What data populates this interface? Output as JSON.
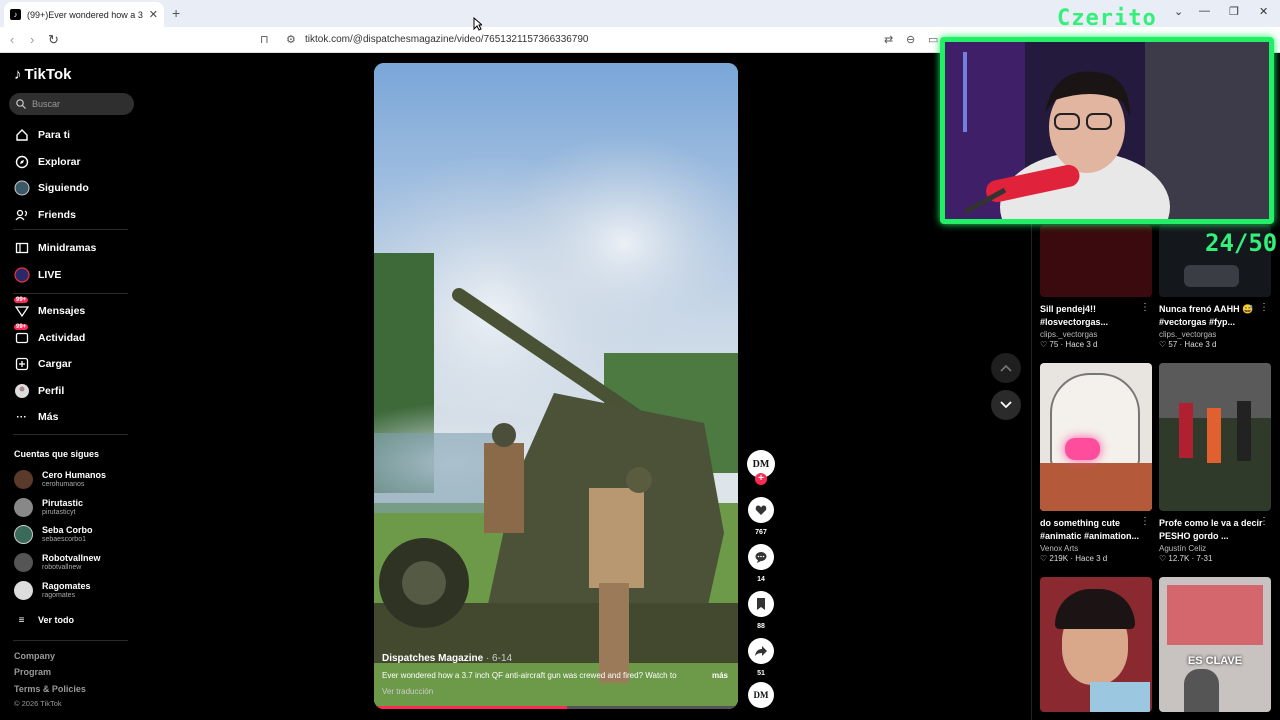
{
  "browser": {
    "tab_title": "(99+)Ever wondered how a 3",
    "url": "tiktok.com/@dispatchesmagazine/video/7651321157366336790"
  },
  "sidebar": {
    "brand": "TikTok",
    "search_placeholder": "Buscar",
    "nav": [
      {
        "label": "Para ti",
        "icon": "home-icon"
      },
      {
        "label": "Explorar",
        "icon": "compass-icon"
      },
      {
        "label": "Siguiendo",
        "icon": "following-icon"
      },
      {
        "label": "Friends",
        "icon": "friends-icon"
      },
      {
        "label": "Minidramas",
        "icon": "minidramas-icon"
      },
      {
        "label": "LIVE",
        "icon": "live-icon"
      },
      {
        "label": "Mensajes",
        "icon": "messages-icon",
        "badge": "99+"
      },
      {
        "label": "Actividad",
        "icon": "activity-icon",
        "badge": "99+"
      },
      {
        "label": "Cargar",
        "icon": "upload-icon"
      },
      {
        "label": "Perfil",
        "icon": "profile-icon"
      },
      {
        "label": "Más",
        "icon": "more-icon"
      }
    ],
    "following_title": "Cuentas que sigues",
    "following": [
      {
        "name": "Cero Humanos",
        "handle": "cerohumanos"
      },
      {
        "name": "Pirutastic",
        "handle": "pirutasticyt"
      },
      {
        "name": "Seba Corbo",
        "handle": "sebaescorbo1"
      },
      {
        "name": "Robotvallnew",
        "handle": "robotvallnew"
      },
      {
        "name": "Ragomates",
        "handle": "ragomates"
      }
    ],
    "see_all": "Ver todo",
    "footer": [
      "Company",
      "Program",
      "Terms & Policies"
    ],
    "copyright": "© 2026 TikTok"
  },
  "video": {
    "author": "Dispatches Magazine",
    "date": "· 6-14",
    "description": "Ever wondered how a 3.7 inch QF anti-aircraft gun was crewed and fired? Watch to",
    "more": "más",
    "translate": "Ver traducción",
    "progress": 0.53,
    "avatar_text": "DM",
    "likes": "767",
    "comments": "14",
    "saves": "88",
    "shares": "51"
  },
  "recommended": [
    {
      "title": "Sill pendej4!! #losvectorgas...",
      "author": "clips._vectorgas",
      "likes": "75",
      "date": "· Hace 3 d"
    },
    {
      "title": "Nunca frenó AAHH 😅 #vectorgas #fyp...",
      "author": "clips._vectorgas",
      "likes": "57",
      "date": "· Hace 3 d"
    },
    {
      "title": "do something cute #animatic #animation...",
      "author": "Venox Arts",
      "likes": "219K",
      "date": "· Hace 3 d"
    },
    {
      "title": "Profe como le va a decir PESHO gordo ...",
      "author": "Agustín Celiz",
      "likes": "12.7K",
      "date": "· 7-31"
    },
    {
      "overlay_text": "ES CLAVE"
    }
  ],
  "overlay": {
    "streamer": "Czerito",
    "counter": "24/50"
  },
  "colors": {
    "accent": "#fe2c55",
    "overlay_green": "#32f07a"
  }
}
